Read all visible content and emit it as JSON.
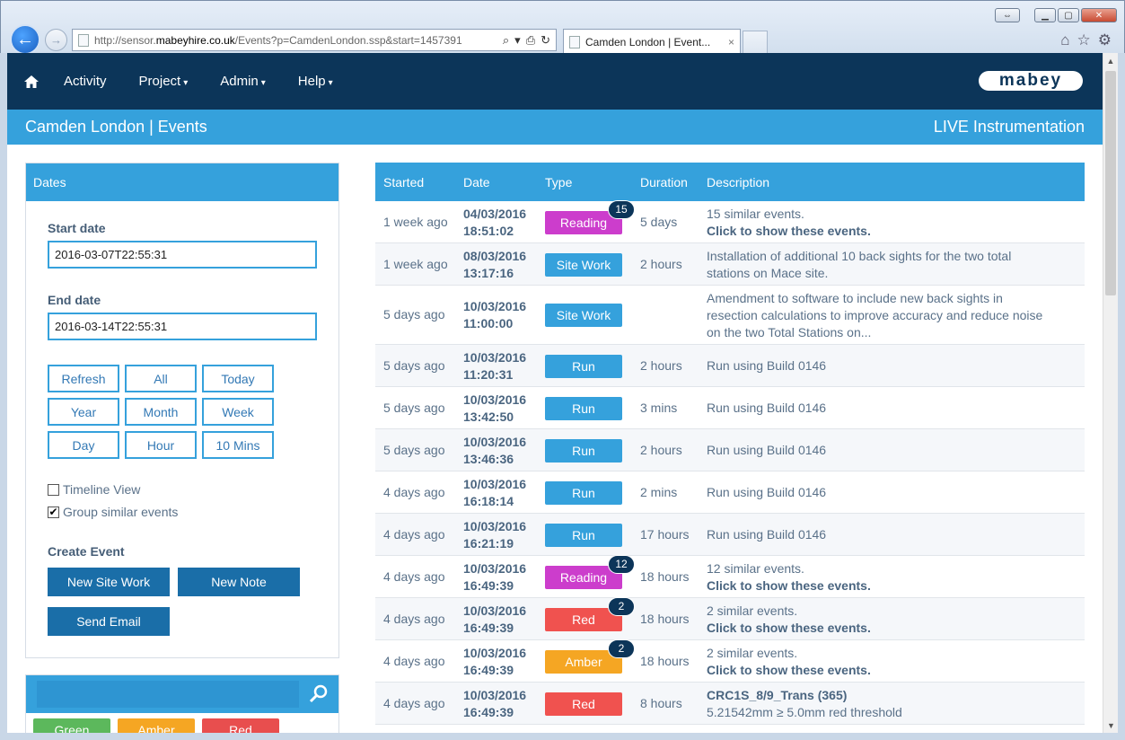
{
  "browser": {
    "url_prefix": "http://sensor.",
    "url_domain": "mabeyhire.co.uk",
    "url_rest": "/Events?p=CamdenLondon.ssp&start=1457391",
    "tab_title": "Camden London | Event...",
    "tab_close": "×"
  },
  "nav": {
    "items": [
      {
        "label": "Activity",
        "caret": ""
      },
      {
        "label": "Project",
        "caret": "▾"
      },
      {
        "label": "Admin",
        "caret": "▾"
      },
      {
        "label": "Help",
        "caret": "▾"
      }
    ],
    "logo": "mabey"
  },
  "header": {
    "title": "Camden London | Events",
    "subtitle": "LIVE Instrumentation"
  },
  "dates_panel": {
    "title": "Dates",
    "start_label": "Start date",
    "start_value": "2016-03-07T22:55:31",
    "end_label": "End date",
    "end_value": "2016-03-14T22:55:31",
    "range_buttons": [
      "Refresh",
      "All",
      "Today",
      "Year",
      "Month",
      "Week",
      "Day",
      "Hour",
      "10 Mins"
    ],
    "timeline_view": {
      "label": "Timeline View",
      "checked": false
    },
    "group_similar": {
      "label": "Group similar events",
      "checked": true
    },
    "create_event_label": "Create Event",
    "new_site_work": "New Site Work",
    "new_note": "New Note",
    "send_email": "Send Email"
  },
  "filters": {
    "buttons": [
      {
        "label": "Green",
        "color": "#5cb85c"
      },
      {
        "label": "Amber",
        "color": "#f5a623"
      },
      {
        "label": "Red",
        "color": "#e84e4e"
      }
    ]
  },
  "colors": {
    "navy": "#0c3559",
    "accent": "#35a1dc",
    "reading": "#cc3dcc",
    "sitework": "#35a1dc",
    "run": "#35a1dc",
    "red": "#f0524f",
    "amber": "#f5a623"
  },
  "table": {
    "headers": [
      "Started",
      "Date",
      "Type",
      "Duration",
      "Description"
    ],
    "rows": [
      {
        "started": "1 week ago",
        "date1": "04/03/2016",
        "date2": "18:51:02",
        "type": "Reading",
        "color": "#cc3dcc",
        "count": "15",
        "duration": "5 days",
        "desc1": "15 similar events.",
        "desc2": "Click to show these events.",
        "desc3": ""
      },
      {
        "started": "1 week ago",
        "date1": "08/03/2016",
        "date2": "13:17:16",
        "type": "Site Work",
        "color": "#35a1dc",
        "count": "",
        "duration": "2 hours",
        "desc1": "Installation of additional 10 back sights for the two total",
        "desc2": "",
        "desc3": "stations on Mace site."
      },
      {
        "started": "5 days ago",
        "date1": "10/03/2016",
        "date2": "11:00:00",
        "type": "Site Work",
        "color": "#35a1dc",
        "count": "",
        "duration": "",
        "desc1": "Amendment to software to include new back sights in",
        "desc2": "",
        "desc3": "resection calculations to improve accuracy and reduce noise",
        "desc4": "on the two Total Stations on..."
      },
      {
        "started": "5 days ago",
        "date1": "10/03/2016",
        "date2": "11:20:31",
        "type": "Run",
        "color": "#35a1dc",
        "count": "",
        "duration": "2 hours",
        "desc1": "Run using Build 0146",
        "desc2": "",
        "desc3": ""
      },
      {
        "started": "5 days ago",
        "date1": "10/03/2016",
        "date2": "13:42:50",
        "type": "Run",
        "color": "#35a1dc",
        "count": "",
        "duration": "3 mins",
        "desc1": "Run using Build 0146",
        "desc2": "",
        "desc3": ""
      },
      {
        "started": "5 days ago",
        "date1": "10/03/2016",
        "date2": "13:46:36",
        "type": "Run",
        "color": "#35a1dc",
        "count": "",
        "duration": "2 hours",
        "desc1": "Run using Build 0146",
        "desc2": "",
        "desc3": ""
      },
      {
        "started": "4 days ago",
        "date1": "10/03/2016",
        "date2": "16:18:14",
        "type": "Run",
        "color": "#35a1dc",
        "count": "",
        "duration": "2 mins",
        "desc1": "Run using Build 0146",
        "desc2": "",
        "desc3": ""
      },
      {
        "started": "4 days ago",
        "date1": "10/03/2016",
        "date2": "16:21:19",
        "type": "Run",
        "color": "#35a1dc",
        "count": "",
        "duration": "17 hours",
        "desc1": "Run using Build 0146",
        "desc2": "",
        "desc3": ""
      },
      {
        "started": "4 days ago",
        "date1": "10/03/2016",
        "date2": "16:49:39",
        "type": "Reading",
        "color": "#cc3dcc",
        "count": "12",
        "duration": "18 hours",
        "desc1": "12 similar events.",
        "desc2": "Click to show these events.",
        "desc3": ""
      },
      {
        "started": "4 days ago",
        "date1": "10/03/2016",
        "date2": "16:49:39",
        "type": "Red",
        "color": "#f0524f",
        "count": "2",
        "duration": "18 hours",
        "desc1": "2 similar events.",
        "desc2": "Click to show these events.",
        "desc3": ""
      },
      {
        "started": "4 days ago",
        "date1": "10/03/2016",
        "date2": "16:49:39",
        "type": "Amber",
        "color": "#f5a623",
        "count": "2",
        "duration": "18 hours",
        "desc1": "2 similar events.",
        "desc2": "Click to show these events.",
        "desc3": ""
      },
      {
        "started": "4 days ago",
        "date1": "10/03/2016",
        "date2": "16:49:39",
        "type": "Red",
        "color": "#f0524f",
        "count": "",
        "duration": "8 hours",
        "desc1": "CRC1S_8/9_Trans (365)",
        "desc2": "",
        "desc3": "5.21542mm ≥ 5.0mm red threshold",
        "desc1_strong": true
      }
    ]
  }
}
